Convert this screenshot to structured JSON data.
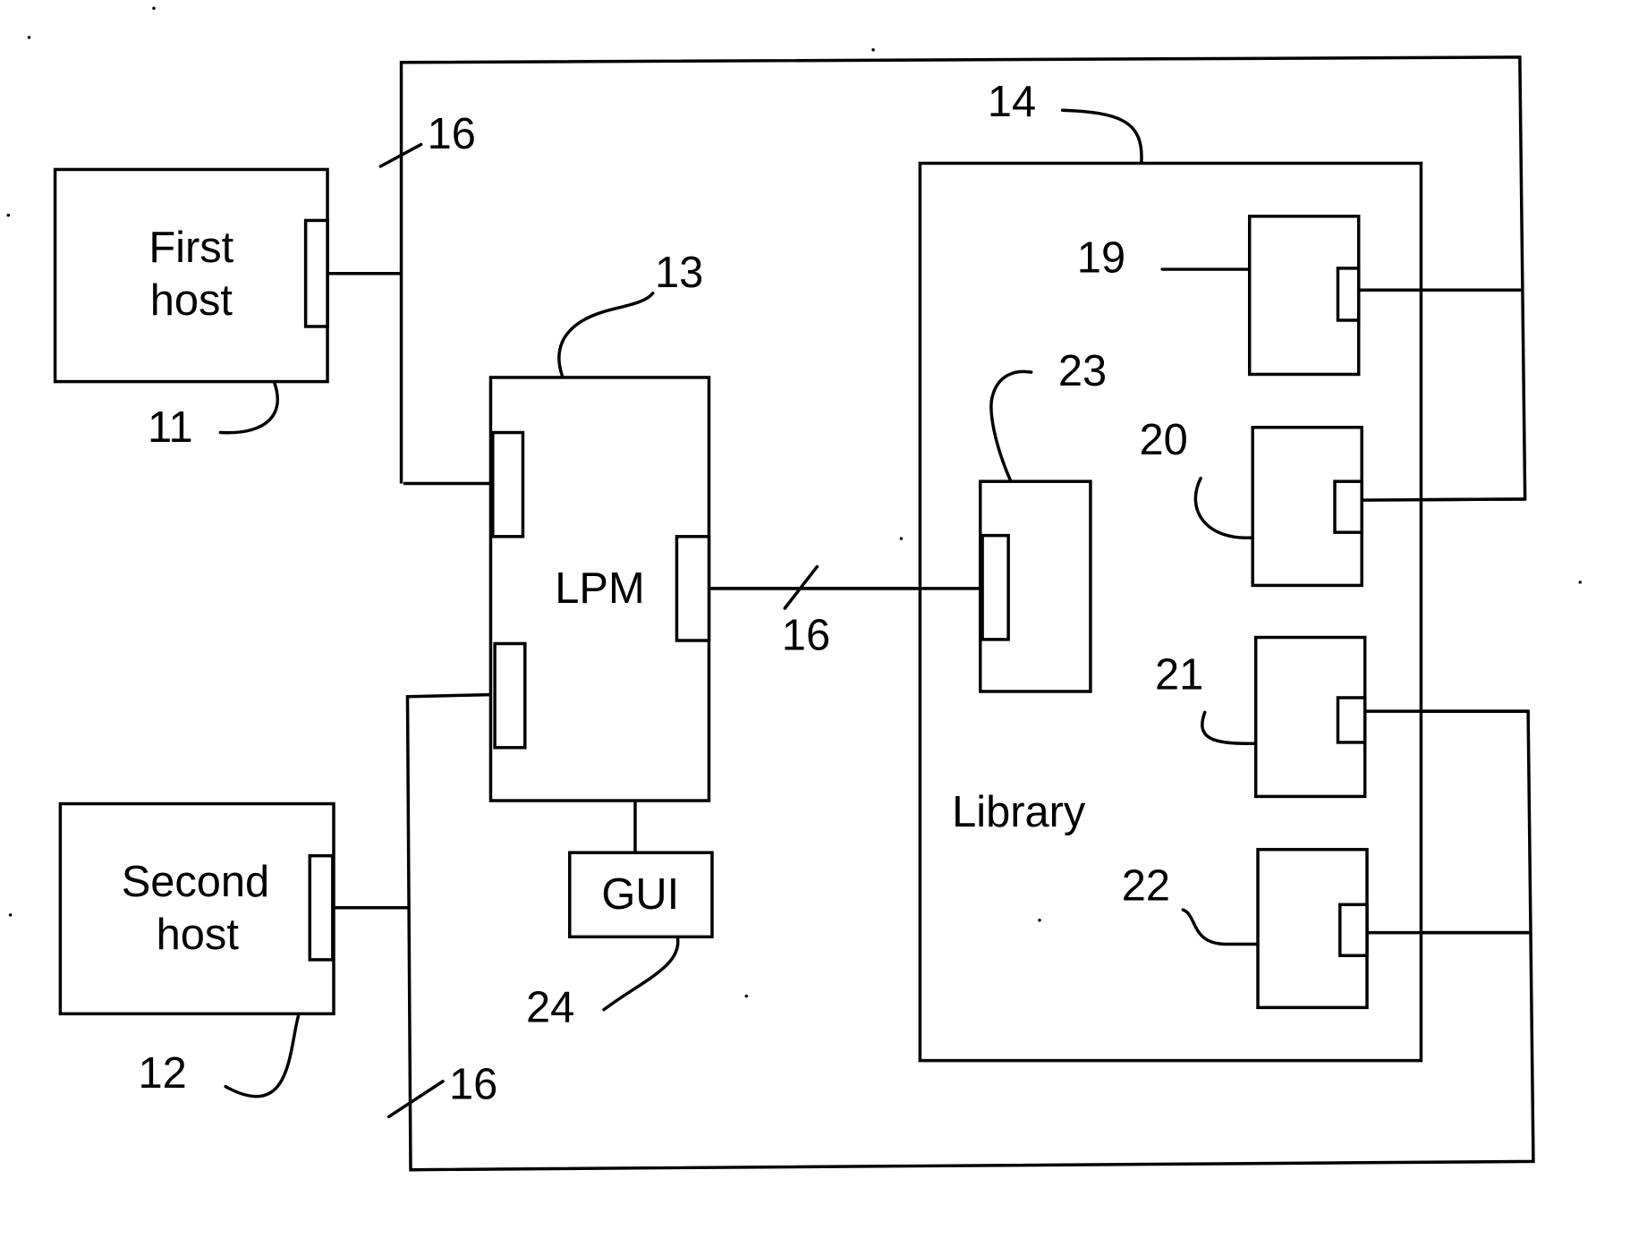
{
  "figure": {
    "components": {
      "first_host": {
        "line1": "First",
        "line2": "host",
        "ref": "11"
      },
      "second_host": {
        "line1": "Second",
        "line2": "host",
        "ref": "12"
      },
      "lpm": {
        "label": "LPM",
        "ref": "13"
      },
      "library": {
        "label": "Library",
        "ref": "14"
      },
      "gui": {
        "label": "GUI",
        "ref": "24"
      },
      "library_controller": {
        "ref": "23"
      },
      "drives": [
        {
          "ref": "19"
        },
        {
          "ref": "20"
        },
        {
          "ref": "21"
        },
        {
          "ref": "22"
        }
      ]
    },
    "bus_labels": {
      "top": "16",
      "middle": "16",
      "bottom": "16"
    }
  }
}
